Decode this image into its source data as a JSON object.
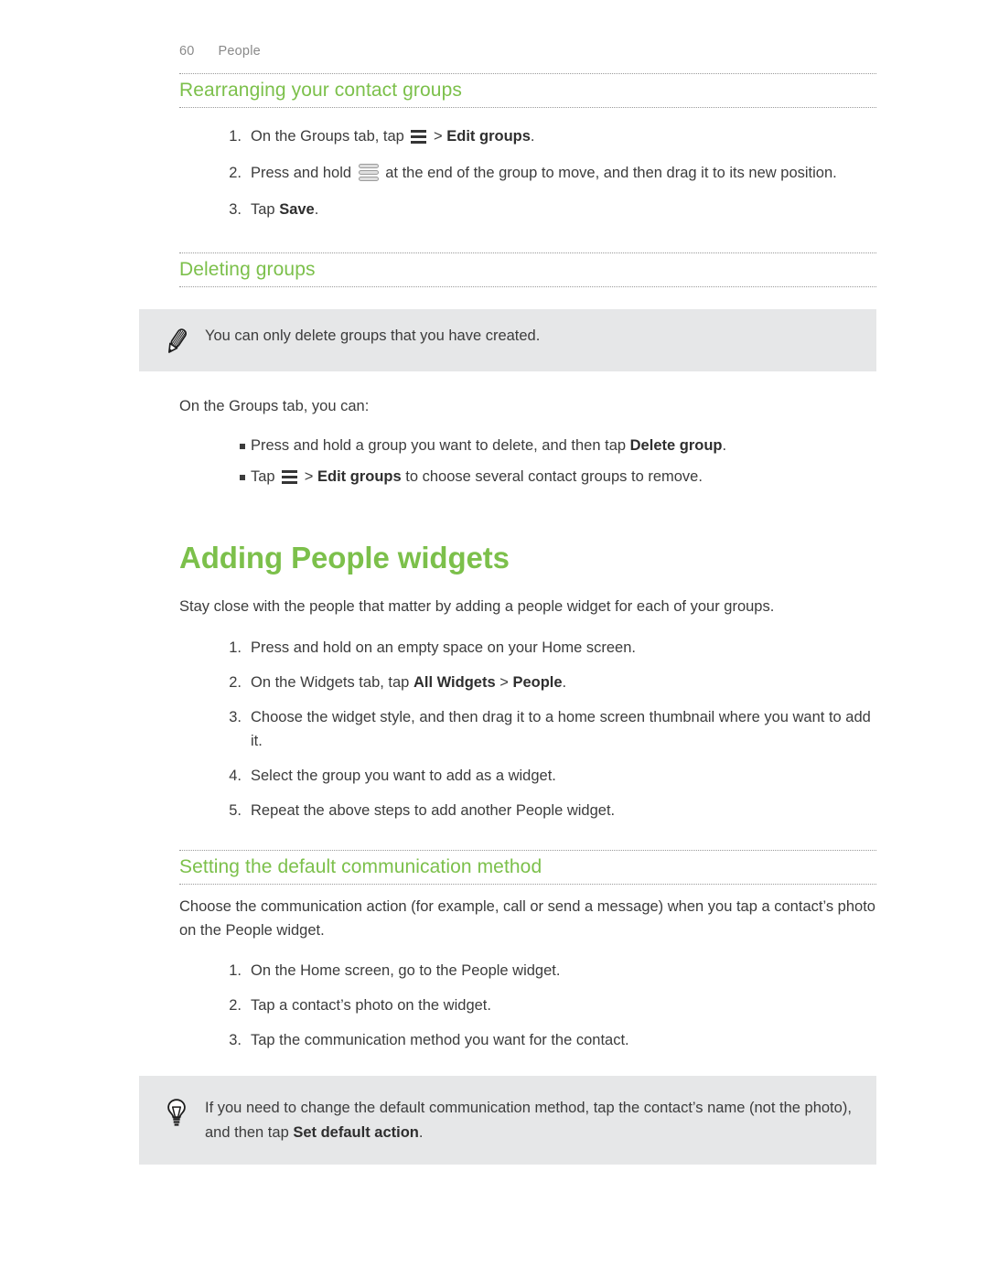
{
  "header": {
    "page_number": "60",
    "chapter": "People"
  },
  "colors": {
    "heading_green": "#7cc04b",
    "callout_bg": "#e6e7e8",
    "body_text": "#3c3c3c",
    "header_text": "#8a8a8a"
  },
  "sections": {
    "rearranging": {
      "heading": "Rearranging your contact groups",
      "steps": [
        {
          "number": "1.",
          "parts": [
            {
              "type": "text",
              "value": "On the Groups tab, tap "
            },
            {
              "type": "icon",
              "value": "menu-icon"
            },
            {
              "type": "text",
              "value": " > "
            },
            {
              "type": "bold",
              "value": "Edit groups"
            },
            {
              "type": "text",
              "value": "."
            }
          ]
        },
        {
          "number": "2.",
          "parts": [
            {
              "type": "text",
              "value": "Press and hold "
            },
            {
              "type": "icon",
              "value": "drag-handle-icon"
            },
            {
              "type": "text",
              "value": " at the end of the group to move, and then drag it to its new position."
            }
          ]
        },
        {
          "number": "3.",
          "parts": [
            {
              "type": "text",
              "value": "Tap "
            },
            {
              "type": "bold",
              "value": "Save"
            },
            {
              "type": "text",
              "value": "."
            }
          ]
        }
      ]
    },
    "deleting": {
      "heading": "Deleting groups",
      "note": {
        "icon": "pencil-icon",
        "text": "You can only delete groups that you have created."
      },
      "intro": "On the Groups tab, you can:",
      "bullets": [
        {
          "parts": [
            {
              "type": "text",
              "value": "Press and hold a group you want to delete, and then tap "
            },
            {
              "type": "bold",
              "value": "Delete group"
            },
            {
              "type": "text",
              "value": "."
            }
          ]
        },
        {
          "parts": [
            {
              "type": "text",
              "value": "Tap "
            },
            {
              "type": "icon",
              "value": "menu-icon"
            },
            {
              "type": "text",
              "value": " > "
            },
            {
              "type": "bold",
              "value": "Edit groups"
            },
            {
              "type": "text",
              "value": " to choose several contact groups to remove."
            }
          ]
        }
      ]
    },
    "adding_widgets": {
      "heading": "Adding People widgets",
      "intro": "Stay close with the people that matter by adding a people widget for each of your groups.",
      "steps": [
        {
          "number": "1.",
          "parts": [
            {
              "type": "text",
              "value": "Press and hold on an empty space on your Home screen."
            }
          ]
        },
        {
          "number": "2.",
          "parts": [
            {
              "type": "text",
              "value": "On the Widgets tab, tap "
            },
            {
              "type": "bold",
              "value": "All Widgets"
            },
            {
              "type": "text",
              "value": " > "
            },
            {
              "type": "bold",
              "value": "People"
            },
            {
              "type": "text",
              "value": "."
            }
          ]
        },
        {
          "number": "3.",
          "parts": [
            {
              "type": "text",
              "value": "Choose the widget style, and then drag it to a home screen thumbnail where you want to add it."
            }
          ]
        },
        {
          "number": "4.",
          "parts": [
            {
              "type": "text",
              "value": "Select the group you want to add as a widget."
            }
          ]
        },
        {
          "number": "5.",
          "parts": [
            {
              "type": "text",
              "value": "Repeat the above steps to add another People widget."
            }
          ]
        }
      ]
    },
    "default_comm": {
      "heading": "Setting the default communication method",
      "intro": "Choose the communication action (for example, call or send a message) when you tap a contact’s photo on the People widget.",
      "steps": [
        {
          "number": "1.",
          "parts": [
            {
              "type": "text",
              "value": "On the Home screen, go to the People widget."
            }
          ]
        },
        {
          "number": "2.",
          "parts": [
            {
              "type": "text",
              "value": "Tap a contact’s photo on the widget."
            }
          ]
        },
        {
          "number": "3.",
          "parts": [
            {
              "type": "text",
              "value": "Tap the communication method you want for the contact."
            }
          ]
        }
      ],
      "tip": {
        "icon": "lightbulb-icon",
        "parts": [
          {
            "type": "text",
            "value": "If you need to change the default communication method, tap the contact’s name (not the photo), and then tap "
          },
          {
            "type": "bold",
            "value": "Set default action"
          },
          {
            "type": "text",
            "value": "."
          }
        ]
      }
    }
  }
}
